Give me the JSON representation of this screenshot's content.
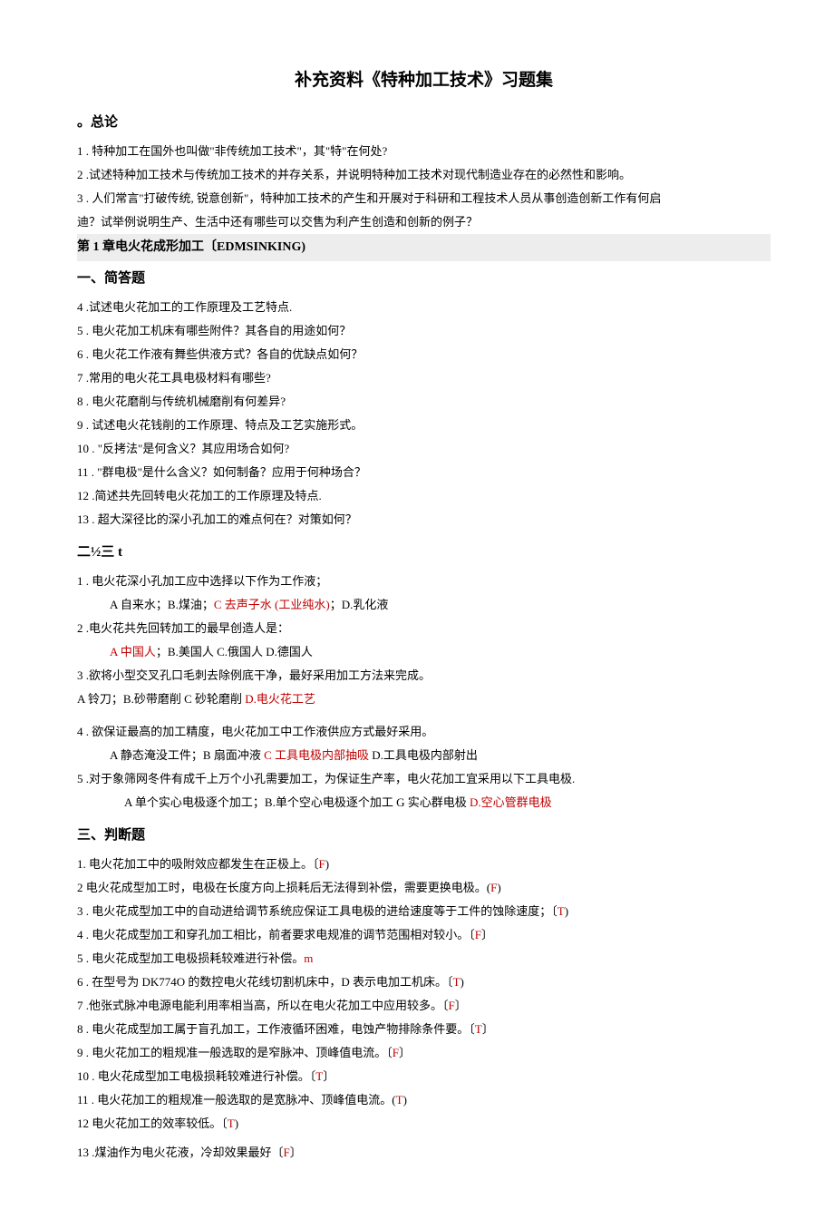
{
  "title": "补充资料《特种加工技术》习题集",
  "sec_intro": "。总论",
  "intro": {
    "q1": "1 . 特种加工在国外也叫做\"非传统加工技术\"，其\"特\"在何处?",
    "q2": "2 .试述特种加工技术与传统加工技术的并存关系，并说明特种加工技术对现代制造业存在的必然性和影响。",
    "q3a": "3 . 人们常言\"打破传统, 锐意创新\"，特种加工技术的产生和开展对于科研和工程技术人员从事创造创新工作有何启",
    "q3b": "迪？试举例说明生产、生活中还有哪些可以交售为利产生创造和创新的例子？"
  },
  "ch1_header": "第 1 章电火花成形加工〔EDMSINKING)",
  "sec_short": "一、简答题",
  "short": {
    "q4": "4 .试述电火花加工的工作原理及工艺特点.",
    "q5": "5 . 电火花加工机床有哪些附件？其各自的用途如何？",
    "q6": "6 . 电火花工作液有舞些供液方式？各自的优缺点如何？",
    "q7": "7 .常用的电火花工具电极材料有哪些?",
    "q8": "8 . 电火花磨削与传统机械磨削有何差异?",
    "q9": "9 . 试述电火花钱削的工作原理、特点及工艺实施形式。",
    "q10": "10 . \"反拷法\"是何含义？其应用场合如何?",
    "q11": "11 . \"群电极\"是什么含义？如何制备？应用于何种场合？",
    "q12": "12 .简述共先回转电火花加工的工作原理及特点.",
    "q13": "13 . 超大深径比的深小孔加工的难点何在？对策如何？"
  },
  "sec_choice": "二½三 t",
  "choice": {
    "c1": "1 . 电火花深小孔加工应中选择以下作为工作液；",
    "c1a_pre": "A 自来水；B.煤油；",
    "c1a_ans": "C 去声子水 (工业纯水)",
    "c1a_post": "；D.乳化液",
    "c2": "2 .电火花共先回转加工的最早创造人是：",
    "c2a_ans": "A 中国人",
    "c2a_post": "；B.美国人 C.俄国人 D.德国人",
    "c3": "3 .欲将小型交叉孔口毛刺去除例底干净，最好采用加工方法来完成。",
    "c3a_pre": "A 铃刀；B.砂带磨削 C 砂轮磨削 ",
    "c3a_ans": "D.电火花工艺",
    "c4": "4 . 欲保证最高的加工精度，电火花加工中工作液供应方式最好采用。",
    "c4a_pre": "A 静态淹没工件；B 扇面冲液 ",
    "c4a_ans": "C 工具电极内部抽吸 ",
    "c4a_post": "D.工具电极内部射出",
    "c5": "5 .对于象筛网冬件有成千上万个小孔需要加工，为保证生产率，电火花加工宜采用以下工具电极.",
    "c5a_pre": "A 单个实心电极逐个加工；B.单个空心电极逐个加工 G 实心群电极 ",
    "c5a_ans": "D.空心管群电极"
  },
  "sec_judge": "三、判断题",
  "judge": {
    "j1_pre": "1. 电火花加工中的吸附效应都发生在正极上。〔",
    "j1_ans": "F",
    "j1_post": ")",
    "j2_pre": "2 电火花成型加工时，电极在长度方向上损耗后无法得到补偿，需要更换电极。(",
    "j2_ans": "F",
    "j2_post": ")",
    "j3_pre": "3 . 电火花成型加工中的自动进给调节系统应保证工具电极的进给速度等于工件的蚀除速度；〔",
    "j3_ans": "T",
    "j3_post": ")",
    "j4_pre": "4 . 电火花成型加工和穿孔加工相比，前者要求电规准的调节范围相对较小。〔",
    "j4_ans": "F",
    "j4_post": "〕",
    "j5_pre": "5 . 电火花成型加工电极损耗较难进行补偿。",
    "j5_ans": "m",
    "j6_pre": "6 . 在型号为 DK774O 的数控电火花线切割机床中，D 表示电加工机床。〔",
    "j6_ans": "T",
    "j6_post": ")",
    "j7_pre": "7 .他张式脉冲电源电能利用率相当高，所以在电火花加工中应用较多。〔",
    "j7_ans": "F",
    "j7_post": "〕",
    "j8_pre": "8 . 电火花成型加工属于盲孔加工，工作液循环困难，电蚀产物排除条件要。〔",
    "j8_ans": "T",
    "j8_post": "〕",
    "j9_pre": "9 . 电火花加工的粗规准一般选取的是窄脉冲、顶峰值电流。〔",
    "j9_ans": "F",
    "j9_post": "〕",
    "j10_pre": "10 . 电火花成型加工电极损耗较难进行补偿。〔",
    "j10_ans": "T",
    "j10_post": "〕",
    "j11_pre": "11 . 电火花加工的粗规准一般选取的是宽脉冲、顶峰值电流。(",
    "j11_ans": "T",
    "j11_post": ")",
    "j12_pre": "12 电火花加工的效率较低。〔",
    "j12_ans": "T",
    "j12_post": ")",
    "j13_pre": "13 .煤油作为电火花液，冷却效果最好〔",
    "j13_ans": "F",
    "j13_post": "〕"
  }
}
